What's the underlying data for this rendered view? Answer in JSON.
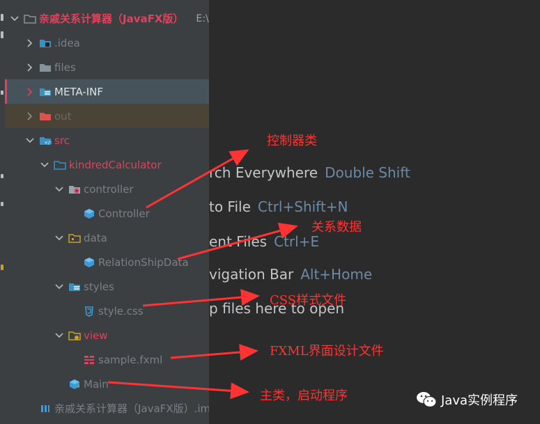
{
  "project_tree": {
    "items": [
      {
        "label": "亲戚关系计算器（JavaFX版）",
        "path": "E:\\Gi"
      },
      {
        "label": ".idea"
      },
      {
        "label": "files"
      },
      {
        "label": "META-INF"
      },
      {
        "label": "out"
      },
      {
        "label": "src"
      },
      {
        "label": "kindredCalculator"
      },
      {
        "label": "controller"
      },
      {
        "label": "Controller"
      },
      {
        "label": "data"
      },
      {
        "label": "RelationShipData"
      },
      {
        "label": "styles"
      },
      {
        "label": "style.css"
      },
      {
        "label": "view"
      },
      {
        "label": "sample.fxml"
      },
      {
        "label": "Main"
      },
      {
        "label": "亲戚关系计算器（JavaFX版）.iml"
      }
    ]
  },
  "editor_hints": [
    {
      "action": "rch Everywhere",
      "key": "Double Shift"
    },
    {
      "action": "to File",
      "key": "Ctrl+Shift+N"
    },
    {
      "action": "ent Files",
      "key": "Ctrl+E"
    },
    {
      "action": "vigation Bar",
      "key": "Alt+Home"
    },
    {
      "action": "p files here to open",
      "key": ""
    }
  ],
  "annotations": [
    "控制器类",
    "关系数据",
    "CSS样式文件",
    "FXML界面设计文件",
    "主类，启动程序"
  ],
  "watermark": {
    "text": "Java实例程序"
  },
  "colors": {
    "tree_bg": "#3c3f41",
    "editor_bg": "#2b2b2b",
    "selected_row": "#46535b",
    "excluded_row": "#4a4436",
    "source_red": "#e0415b",
    "annotation_red": "#ff3333"
  }
}
